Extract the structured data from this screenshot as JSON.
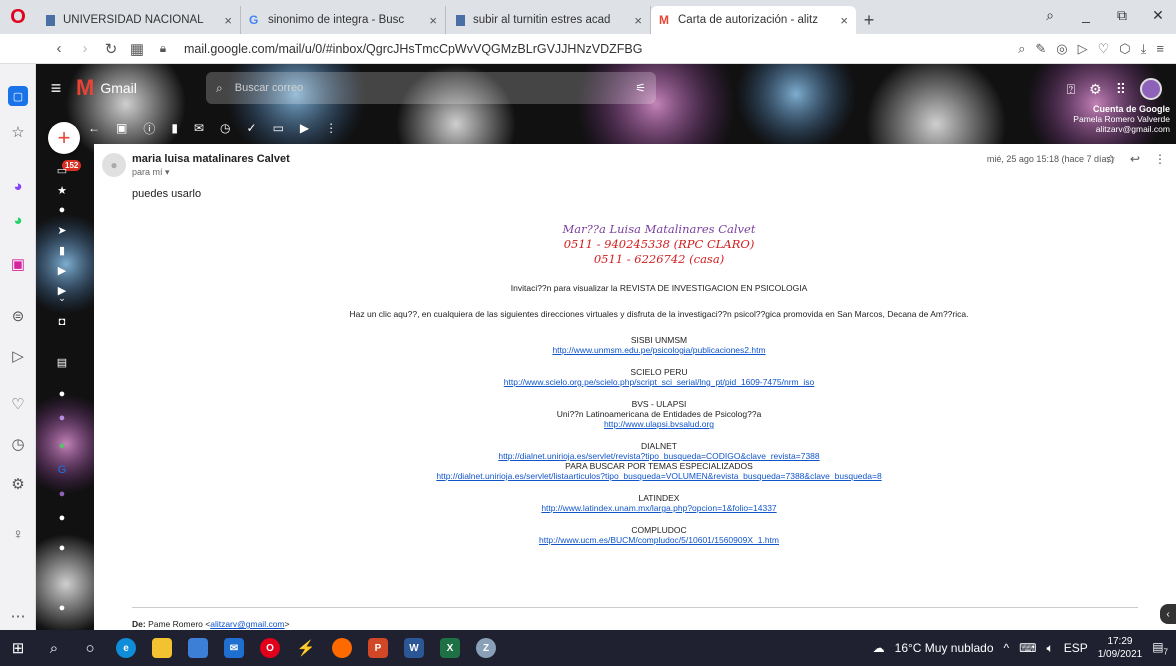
{
  "browser": {
    "tabs": [
      {
        "title": "UNIVERSIDAD NACIONAL",
        "icon": "document-icon",
        "active": false
      },
      {
        "title": "sinonimo de integra - Busc",
        "icon": "google-icon",
        "active": false
      },
      {
        "title": "subir al turnitin estres acad",
        "icon": "document-icon",
        "active": false
      },
      {
        "title": "Carta de autorización - alitz",
        "icon": "gmail-icon",
        "active": true
      }
    ],
    "url": "mail.google.com/mail/u/0/#inbox/QgrcJHsTmcCpWvVQGMzBLrGVJJHNzVDZFBG"
  },
  "gmail": {
    "brand": "Gmail",
    "search_placeholder": "Buscar correo",
    "badge_count": "152",
    "account_tip": {
      "title": "Cuenta de Google",
      "name": "Pamela Romero Valverde",
      "email": "alitzarv@gmail.com"
    }
  },
  "mail": {
    "sender": "maria luisa matalinares Calvet",
    "to": "para mí",
    "date": "mié, 25 ago 15:18 (hace 7 días)",
    "short_text": "puedes usarlo",
    "signature": [
      "Mar??a Luisa Matalinares Calvet",
      "0511 - 940245338 (RPC CLARO)",
      "0511 - 6226742 (casa)"
    ],
    "invitation": "Invitaci??n para visualizar la REVISTA DE INVESTIGACION EN PSICOLOGIA",
    "intro": "Haz un clic aqu??,  en cualquiera de las siguientes direcciones virtuales y disfruta de la investigaci??n psicol??gica promovida en San Marcos, Decana de Am??rica.",
    "sisbi": {
      "title": "SISBI UNMSM",
      "link": "http://www.unmsm.edu.pe/psicologia/publicaciones2.htm"
    },
    "scielo": {
      "title": "SCIELO PERU",
      "link": "http://www.scielo.org.pe/scielo.php/script_sci_serial/lng_pt/pid_1609-7475/nrm_iso"
    },
    "bvs": {
      "title": "BVS - ULAPSI",
      "subtitle": "Uni??n Latinoamericana de Entidades de Psicolog??a",
      "link": "http://www.ulapsi.bvsalud.org"
    },
    "dialnet": {
      "title": "DIALNET",
      "link": "http://dialnet.unirioja.es/servlet/revista?tipo_busqueda=CODIGO&clave_revista=7388",
      "subtitle": "PARA BUSCAR POR TEMAS ESPECIALIZADOS",
      "link2": "http://dialnet.unirioja.es/servlet/listaarticulos?tipo_busqueda=VOLUMEN&revista_busqueda=7388&clave_busqueda=8"
    },
    "latindex": {
      "title": "LATINDEX",
      "link": "http://www.latindex.unam.mx/larga.php?opcion=1&folio=14337"
    },
    "compludoc": {
      "title": "COMPLUDOC",
      "link": "http://www.ucm.es/BUCM/compludoc/5/10601/1560909X_1.htm"
    },
    "from_label": "De:",
    "from_name": "Pame Romero",
    "from_email": "alitzarv@gmail.com"
  },
  "taskbar": {
    "weather": "16°C  Muy nublado",
    "lang": "ESP",
    "time": "17:29",
    "date": "1/09/2021",
    "notif": "7"
  }
}
